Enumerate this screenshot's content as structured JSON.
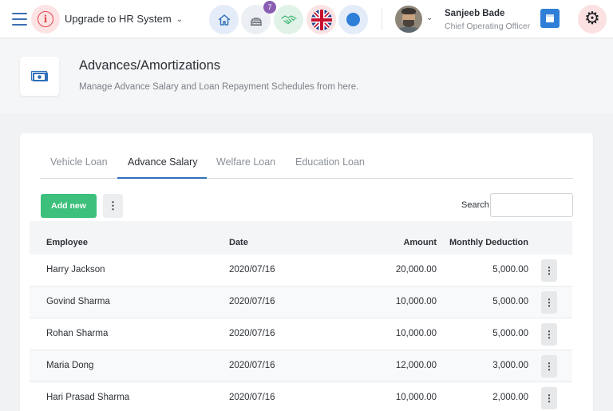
{
  "topbar": {
    "upgrade_label": "Upgrade to HR System",
    "notification_count": "7",
    "user": {
      "name": "Sanjeeb Bade",
      "role": "Chief Operating Officer"
    }
  },
  "header": {
    "title": "Advances/Amortizations",
    "subtitle": "Manage Advance Salary and Loan Repayment Schedules from here."
  },
  "tabs": [
    {
      "label": "Vehicle Loan",
      "active": false
    },
    {
      "label": "Advance Salary",
      "active": true
    },
    {
      "label": "Welfare Loan",
      "active": false
    },
    {
      "label": "Education Loan",
      "active": false
    }
  ],
  "toolbar": {
    "add_label": "Add new",
    "search_label": "Search",
    "search_value": ""
  },
  "table": {
    "columns": [
      "Employee",
      "Date",
      "Amount",
      "Monthly Deduction"
    ],
    "rows": [
      {
        "employee": "Harry Jackson",
        "date": "2020/07/16",
        "amount": "20,000.00",
        "deduction": "5,000.00"
      },
      {
        "employee": "Govind Sharma",
        "date": "2020/07/16",
        "amount": "10,000.00",
        "deduction": "5,000.00"
      },
      {
        "employee": "Rohan Sharma",
        "date": "2020/07/16",
        "amount": "10,000.00",
        "deduction": "5,000.00"
      },
      {
        "employee": "Maria Dong",
        "date": "2020/07/16",
        "amount": "12,000.00",
        "deduction": "3,000.00"
      },
      {
        "employee": "Hari Prasad Sharma",
        "date": "2020/07/16",
        "amount": "10,000.00",
        "deduction": "2,000.00"
      }
    ]
  },
  "icons": {
    "menu": "hamburger-icon",
    "info": "info-icon",
    "home": "home-icon",
    "birthday": "cake-icon",
    "handshake": "handshake-icon",
    "language": "uk-flag-icon",
    "status": "status-dot-icon",
    "calendar": "calendar-icon",
    "settings": "gear-icon",
    "page": "money-icon",
    "row_menu": "kebab-icon"
  },
  "colors": {
    "accent": "#2f6fb8",
    "success": "#3cc07b",
    "badge": "#8a5db3",
    "danger": "#e0474f"
  }
}
